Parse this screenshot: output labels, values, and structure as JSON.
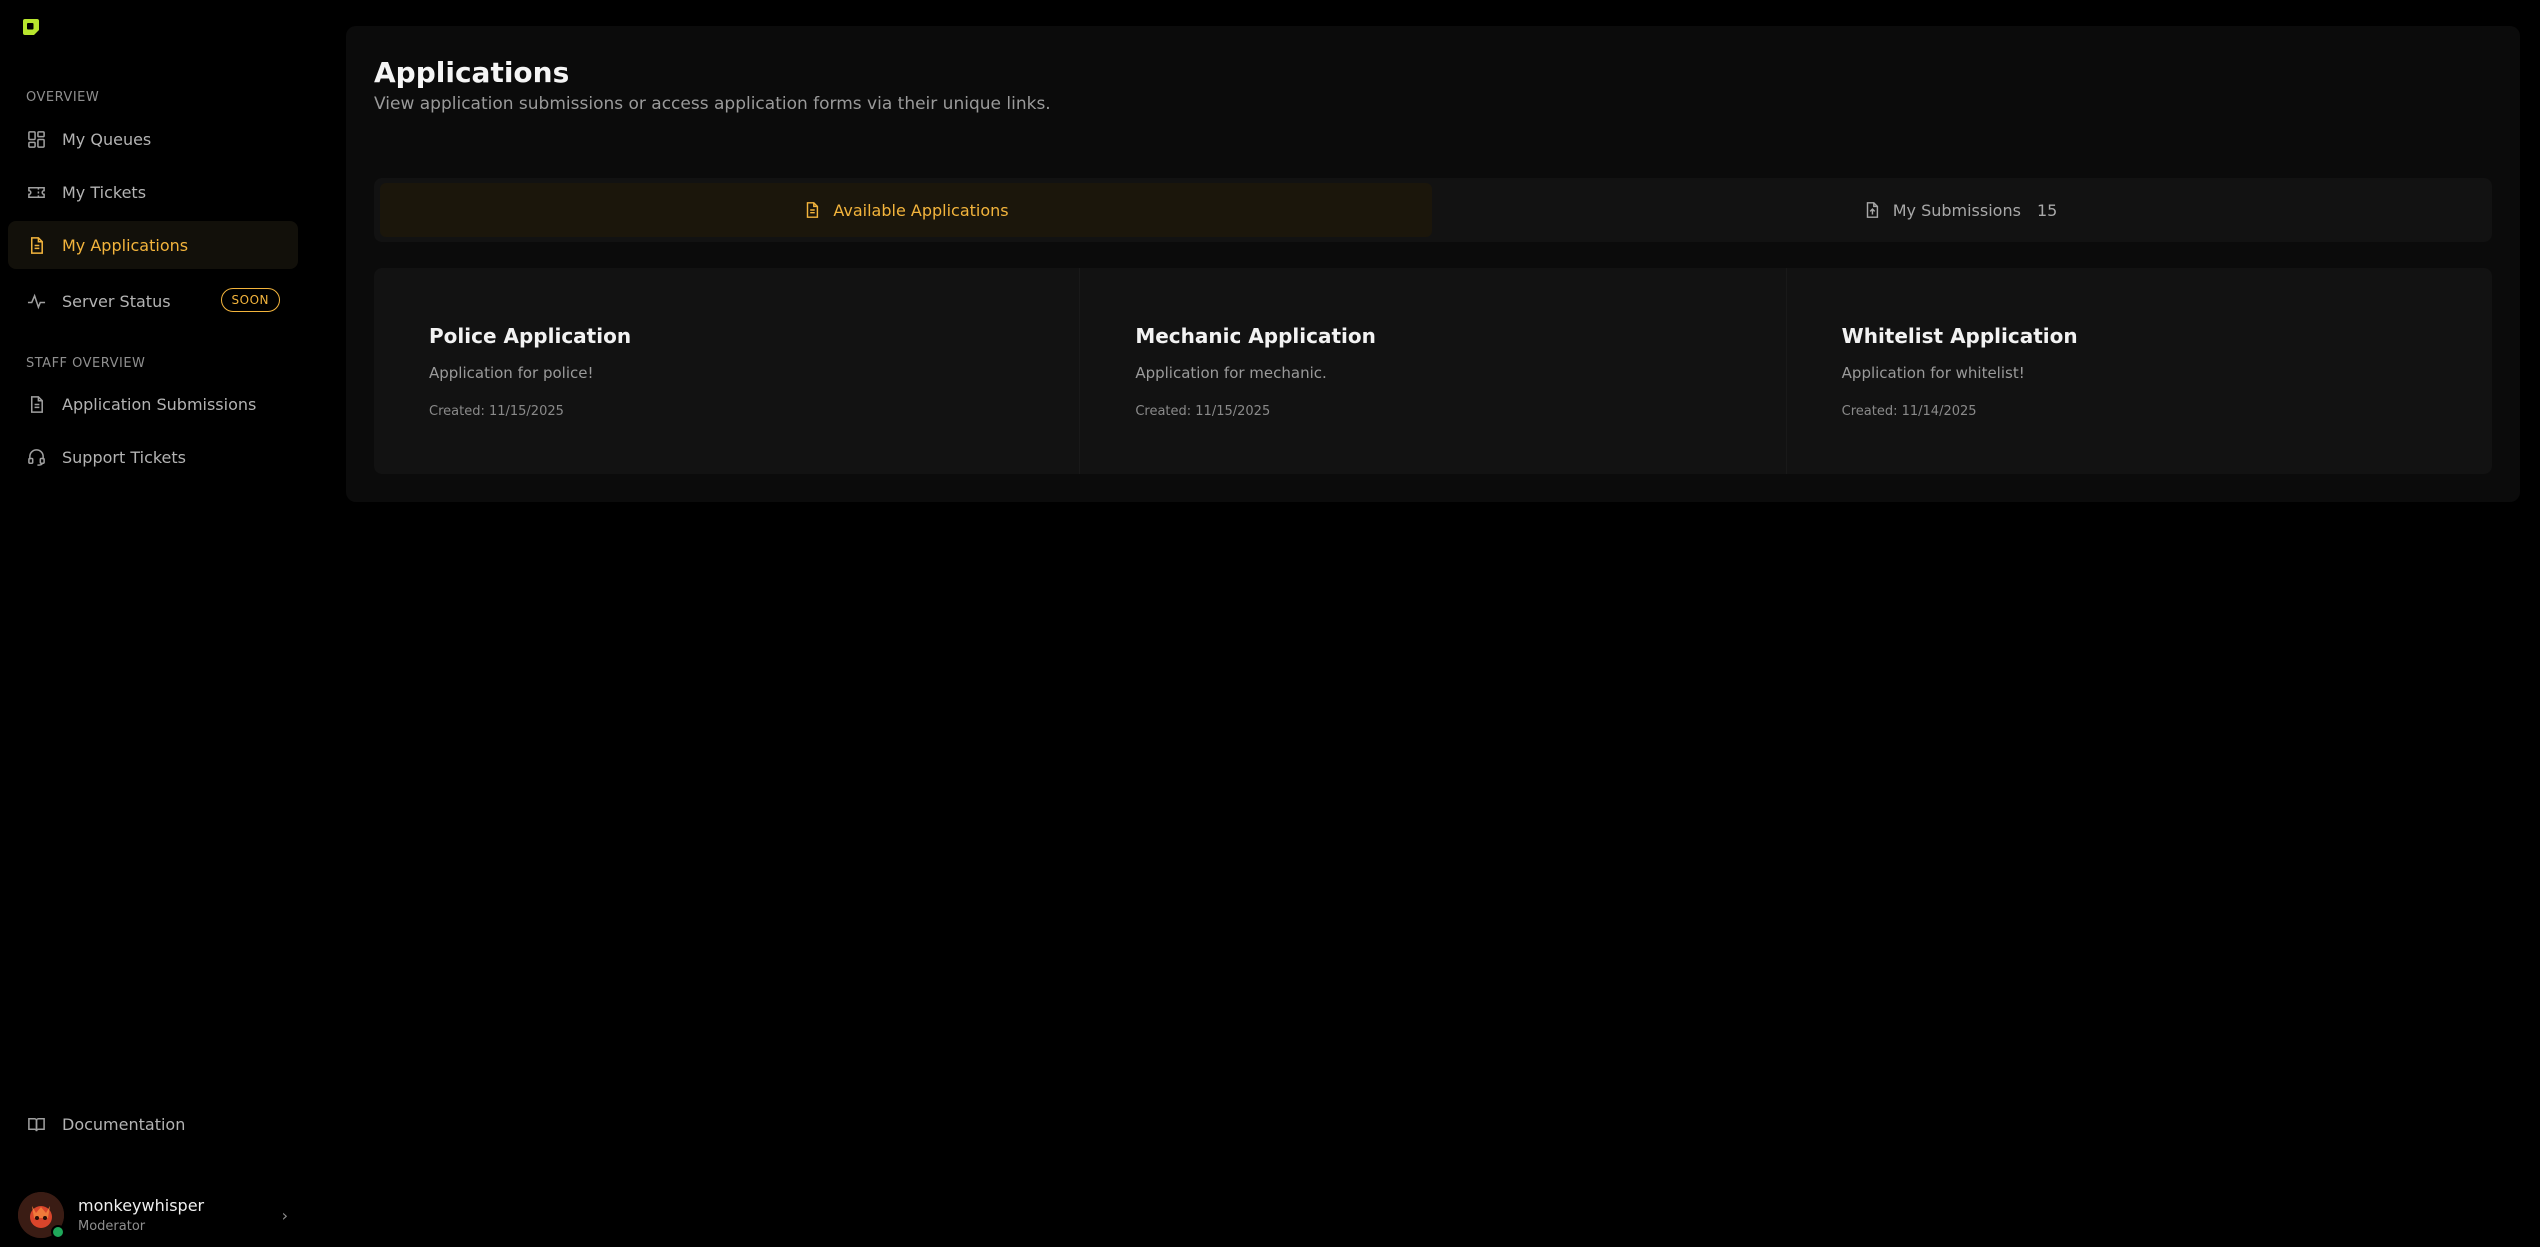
{
  "sidebar": {
    "overview_label": "OVERVIEW",
    "staff_overview_label": "STAFF OVERVIEW",
    "items": {
      "my_queues": "My Queues",
      "my_tickets": "My Tickets",
      "my_applications": "My Applications",
      "server_status": "Server Status",
      "server_status_badge": "SOON",
      "application_submissions": "Application Submissions",
      "support_tickets": "Support Tickets",
      "documentation": "Documentation"
    },
    "user": {
      "name": "monkeywhisper",
      "role": "Moderator"
    }
  },
  "main": {
    "title": "Applications",
    "subtitle": "View application submissions or access application forms via their unique links.",
    "tabs": {
      "available": "Available Applications",
      "submissions": "My Submissions",
      "submissions_count": "15"
    },
    "cards": [
      {
        "title": "Police Application",
        "description": "Application for police!",
        "created": "Created: 11/15/2025"
      },
      {
        "title": "Mechanic Application",
        "description": "Application for mechanic.",
        "created": "Created: 11/15/2025"
      },
      {
        "title": "Whitelist Application",
        "description": "Application for whitelist!",
        "created": "Created: 11/14/2025"
      }
    ]
  },
  "colors": {
    "accent": "#f3b43c",
    "logo": "#b8e62e",
    "online": "#1fa85a"
  }
}
